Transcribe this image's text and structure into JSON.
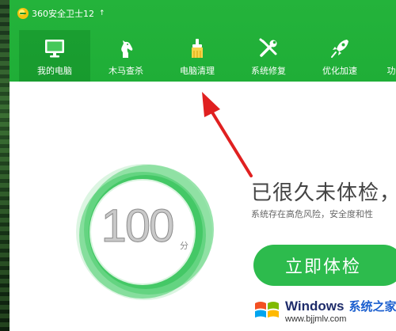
{
  "app": {
    "title": "360安全卫士12",
    "upgrade_glyph": "↑"
  },
  "nav": {
    "items": [
      {
        "label": "我的电脑",
        "icon": "monitor-icon",
        "active": true
      },
      {
        "label": "木马查杀",
        "icon": "horse-icon",
        "active": false
      },
      {
        "label": "电脑清理",
        "icon": "brush-icon",
        "active": false
      },
      {
        "label": "系统修复",
        "icon": "wrench-screwdriver-icon",
        "active": false
      },
      {
        "label": "优化加速",
        "icon": "rocket-icon",
        "active": false
      }
    ]
  },
  "main": {
    "score": "100",
    "score_unit": "分",
    "headline": "已很久未体检，",
    "subtext": "系统存在高危风险，安全度和性",
    "check_button": "立即体检"
  },
  "watermark": {
    "brand": "Windows",
    "site": "系统之家",
    "url": "www.bjjmlv.com"
  },
  "colors": {
    "header_green": "#24b33b",
    "button_green": "#2dbb4d",
    "arrow_red": "#e02020"
  }
}
